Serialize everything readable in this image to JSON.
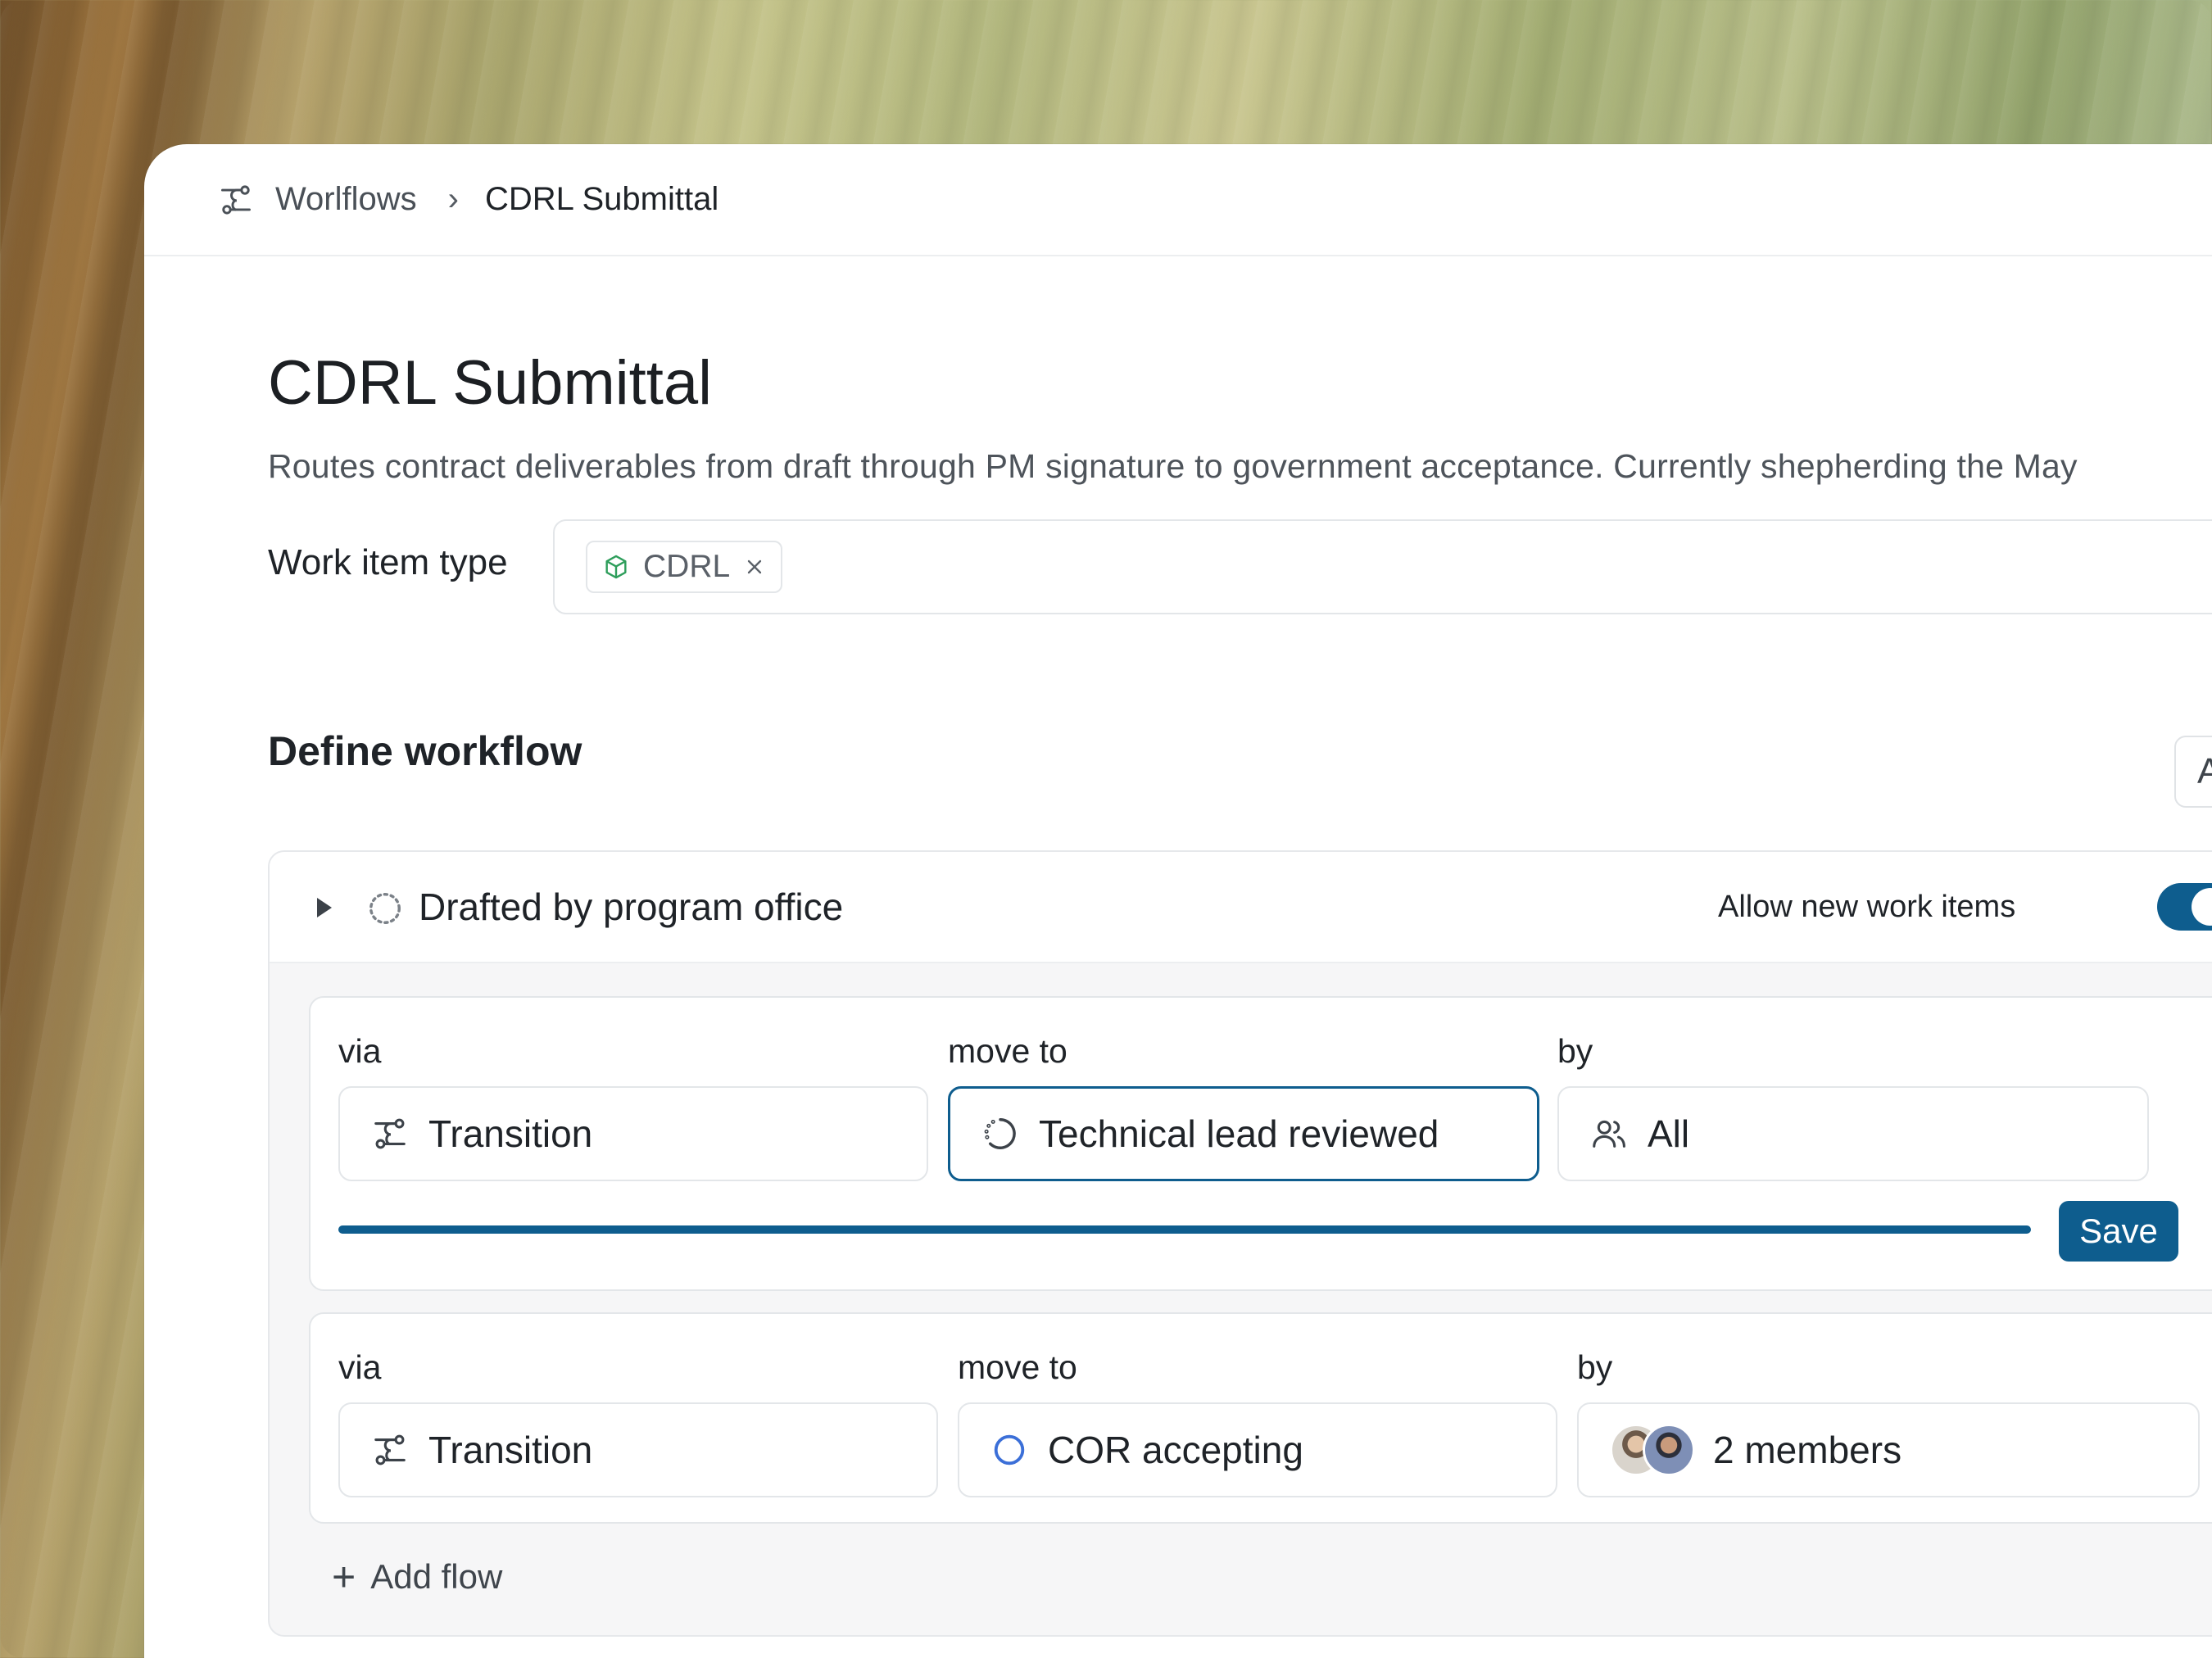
{
  "breadcrumb": {
    "icon": "workflow-icon",
    "parent": "Worlflows",
    "separator": "›",
    "current": "CDRL Submittal"
  },
  "page": {
    "title": "CDRL Submittal",
    "description": "Routes contract deliverables from draft through PM signature to government acceptance. Currently shepherding the May"
  },
  "work_item_type": {
    "label": "Work item type",
    "chip": {
      "label": "CDRL",
      "icon": "cube-icon",
      "icon_color": "#2e9e5b"
    }
  },
  "workflow": {
    "section_title": "Define workflow",
    "add_state_label": "Add stat",
    "state": {
      "name": "Drafted by program office",
      "icon": "dashed-circle-icon",
      "allow_label": "Allow new work items",
      "allow_enabled": true
    },
    "flows": [
      {
        "via_label": "via",
        "via_value": "Transition",
        "move_label": "move to",
        "move_value": "Technical lead reviewed",
        "by_label": "by",
        "by_value": "All",
        "save_label": "Save"
      },
      {
        "via_label": "via",
        "via_value": "Transition",
        "move_label": "move to",
        "move_value": "COR accepting",
        "by_label": "by",
        "by_value": "2 members"
      }
    ],
    "add_flow_label": "Add flow"
  },
  "colors": {
    "accent": "#0e5d8e",
    "state_circle": "#3b6fd8"
  }
}
